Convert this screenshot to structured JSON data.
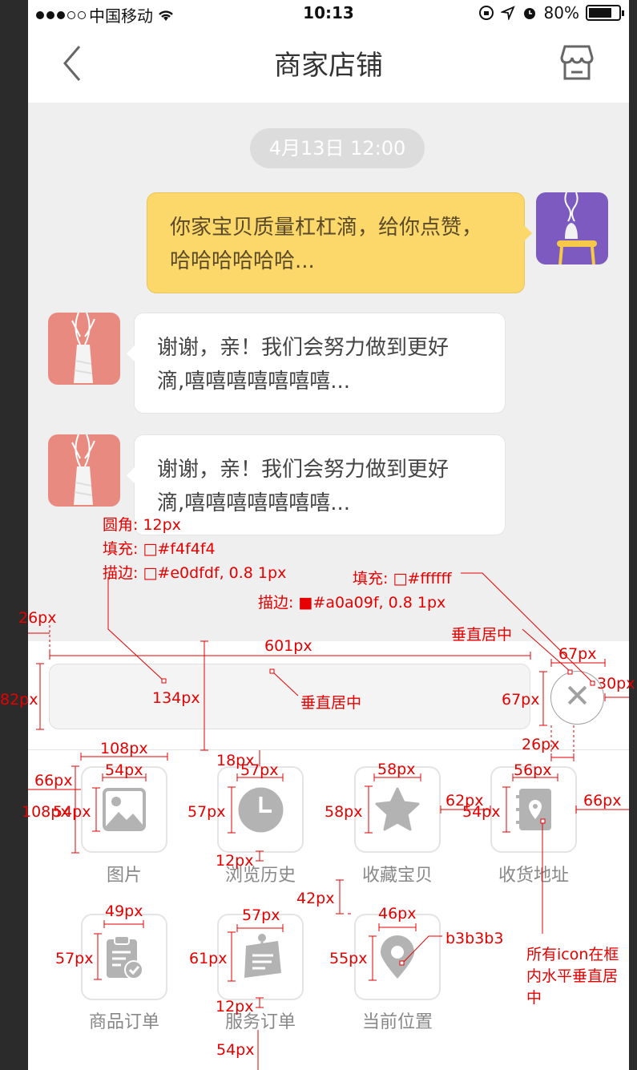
{
  "status_bar": {
    "carrier": "中国移动",
    "time": "10:13",
    "battery": "80%"
  },
  "nav": {
    "title": "商家店铺"
  },
  "chat": {
    "timestamp": "4月13日 12:00",
    "messages": [
      {
        "side": "right",
        "text_line1": "你家宝贝质量杠杠滴，给你点赞，",
        "text_line2": "哈哈哈哈哈哈..."
      },
      {
        "side": "left",
        "text_line1": "谢谢，亲！我们会努力做到更好",
        "text_line2": "滴,嘻嘻嘻嘻嘻嘻嘻..."
      },
      {
        "side": "left",
        "text_line1": "谢谢，亲！我们会努力做到更好",
        "text_line2": "滴,嘻嘻嘻嘻嘻嘻嘻..."
      }
    ]
  },
  "actions": [
    {
      "label": "图片",
      "icon": "image-icon"
    },
    {
      "label": "浏览历史",
      "icon": "clock-icon"
    },
    {
      "label": "收藏宝贝",
      "icon": "star-icon"
    },
    {
      "label": "收货地址",
      "icon": "address-book-icon"
    },
    {
      "label": "商品订单",
      "icon": "clipboard-check-icon"
    },
    {
      "label": "服务订单",
      "icon": "pinned-note-icon"
    },
    {
      "label": "当前位置",
      "icon": "location-pin-icon"
    }
  ],
  "annotations": {
    "radius": "圆角: 12px",
    "fill_box": "填充: □#f4f4f4",
    "stroke_box": "描边: □#e0dfdf, 0.8 1px",
    "fill_btn": "填充: □#ffffff",
    "stroke_btn": "描边: ■#a0a09f, 0.8 1px",
    "center_v_1": "垂直居中",
    "center_v_2": "垂直居中",
    "d26": "26px",
    "d601": "601px",
    "d82": "82px",
    "d134": "134px",
    "d67a": "67px",
    "d67b": "67px",
    "d30": "30px",
    "d26b": "26px",
    "d108a": "108px",
    "d54a": "54px",
    "d66a": "66px",
    "d108b": "108px",
    "d54b": "54px",
    "d18": "18px",
    "d57a": "57px",
    "d57b": "57px",
    "d12a": "12px",
    "d58a": "58px",
    "d58b": "58px",
    "d62": "62px",
    "d54c": "54px",
    "d56": "56px",
    "d66b": "66px",
    "d42": "42px",
    "d49": "49px",
    "d57c": "57px",
    "d57d": "57px",
    "d61": "61px",
    "d12b": "12px",
    "d46": "46px",
    "d55": "55px",
    "d54d": "54px",
    "color_b3": "b3b3b3",
    "note_line1": "所有icon在框",
    "note_line2": "内水平垂直居",
    "note_line3": "中"
  },
  "colors": {
    "bubble_yellow": "#fcd86a",
    "icon_gray": "#b3b3b3",
    "box_fill": "#f4f4f4",
    "box_stroke": "#e0dfdf",
    "btn_stroke": "#a0a09f",
    "annotation": "#e60000"
  }
}
